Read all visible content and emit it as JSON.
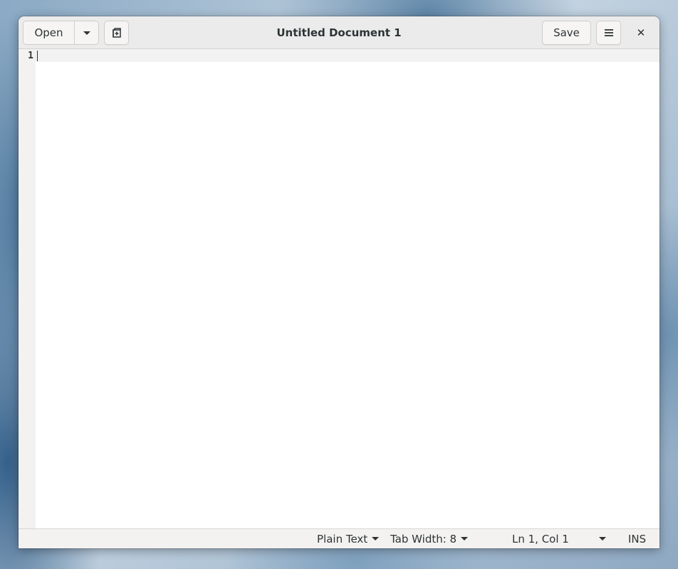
{
  "window": {
    "title": "Untitled Document 1"
  },
  "headerbar": {
    "open_label": "Open",
    "save_label": "Save",
    "new_tab_icon": "new-tab-icon",
    "menu_icon": "hamburger-menu-icon",
    "close_icon": "close-icon",
    "close_glyph": "✕"
  },
  "editor": {
    "line_numbers": [
      "1"
    ],
    "content": ""
  },
  "statusbar": {
    "language": "Plain Text",
    "tab_width": "Tab Width: 8",
    "position": "Ln 1, Col 1",
    "mode": "INS"
  },
  "colors": {
    "headerbar_bg": "#ebebeb",
    "editor_bg": "#ffffff",
    "gutter_bg": "#f3f2f1",
    "text": "#2e3436"
  }
}
